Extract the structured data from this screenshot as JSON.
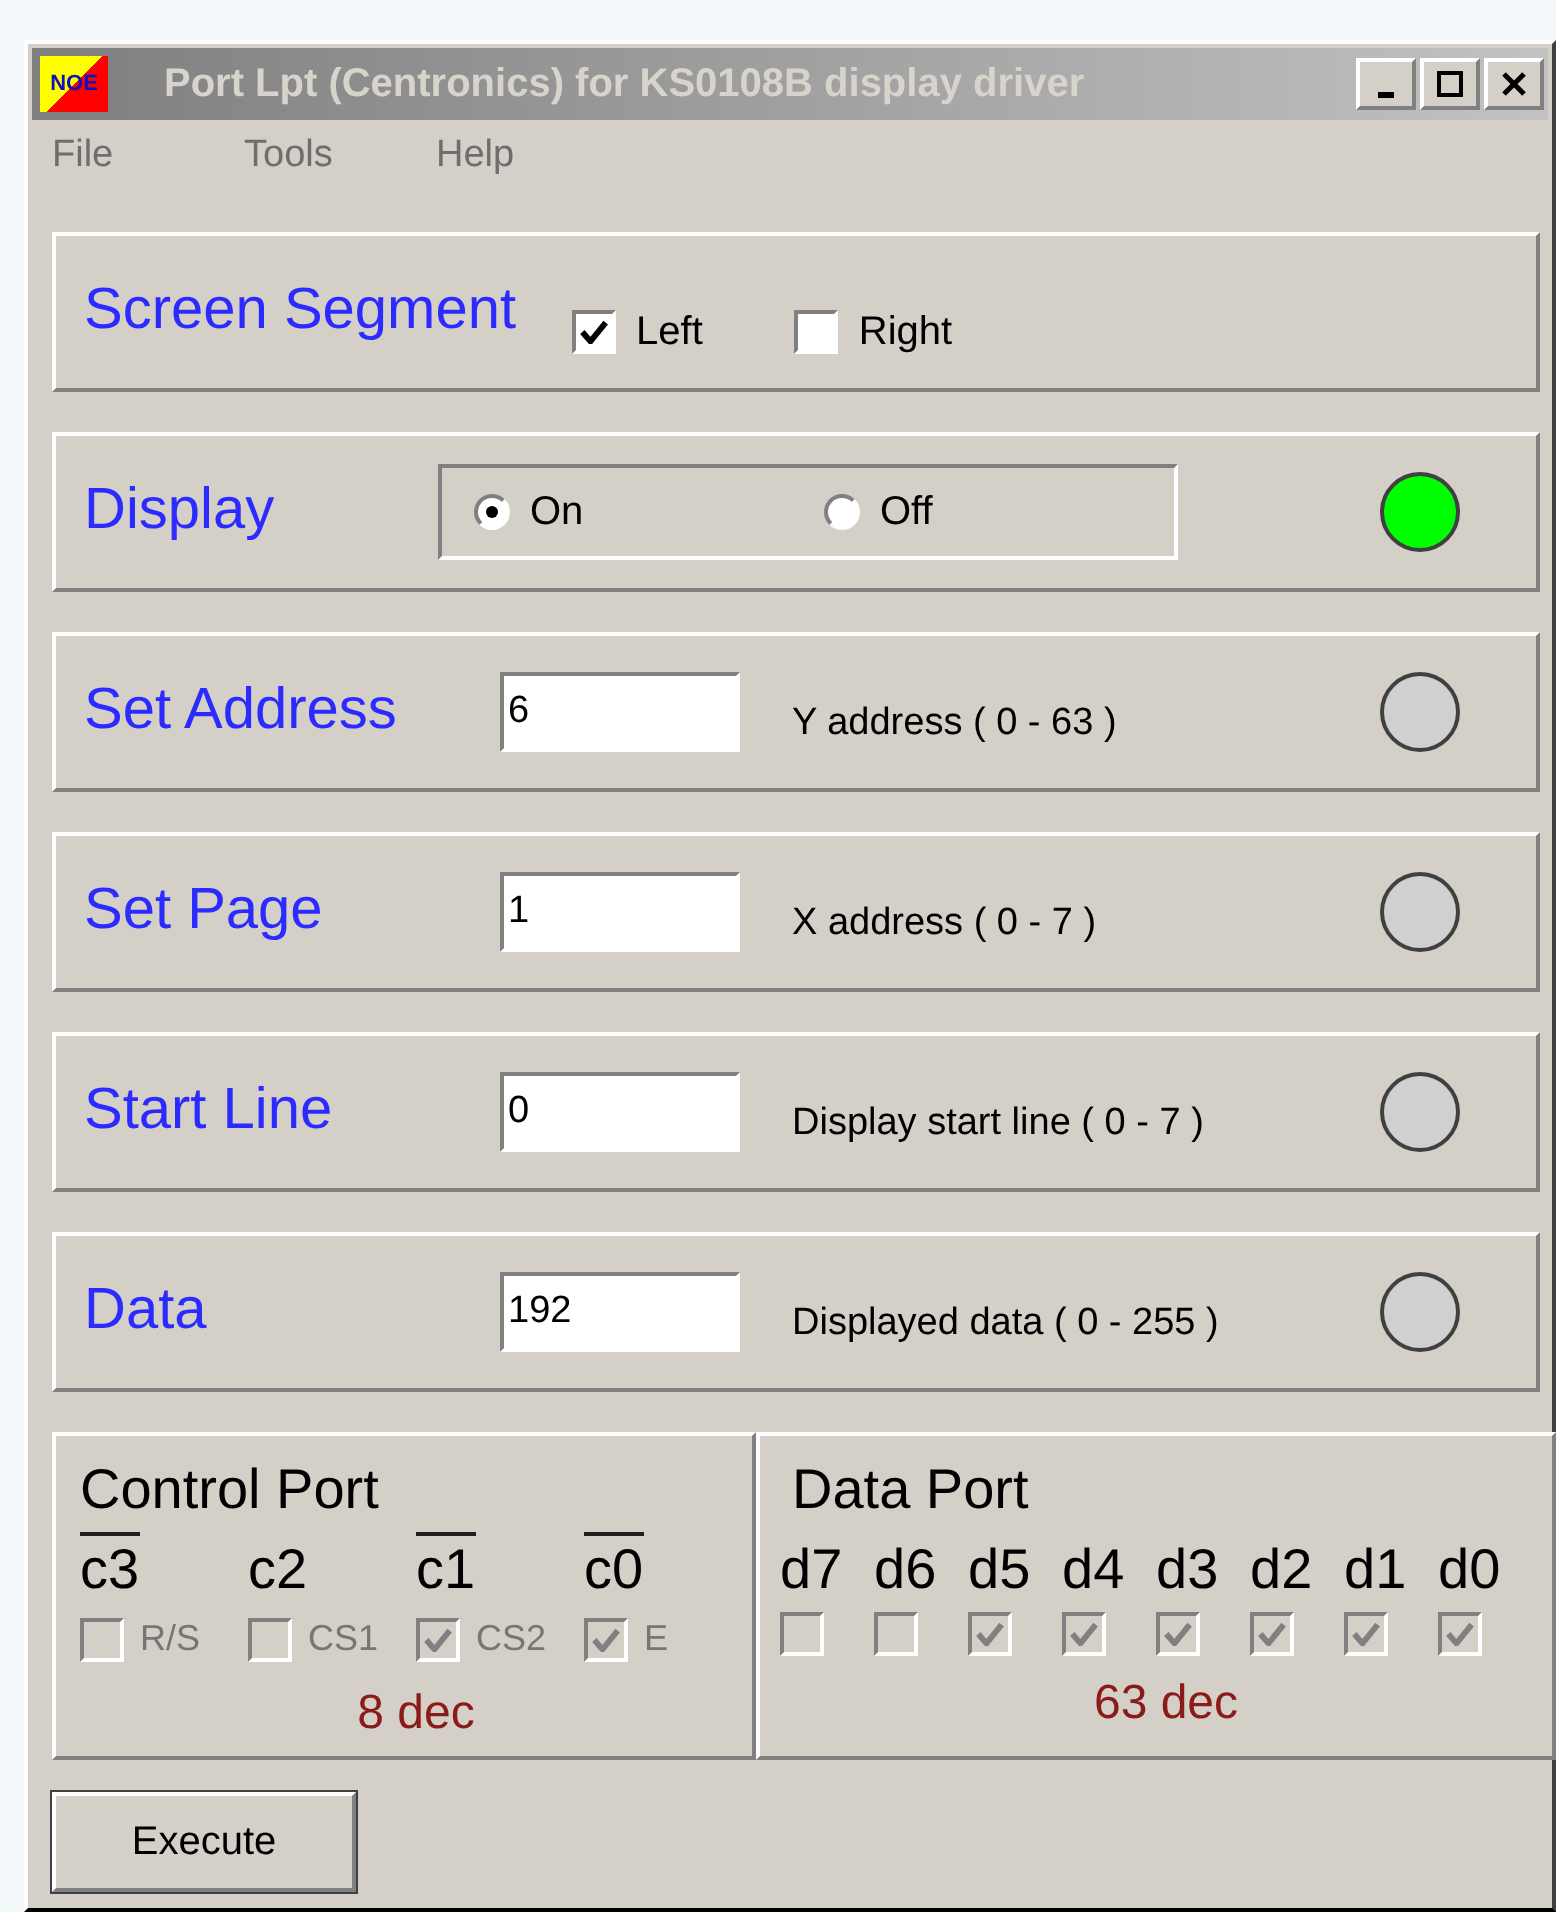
{
  "window": {
    "title": "Port Lpt (Centronics) for KS0108B display driver",
    "logo": "NOE"
  },
  "menu": [
    {
      "label": "File"
    },
    {
      "label": "Tools"
    },
    {
      "label": "Help"
    }
  ],
  "segment": {
    "label": "Screen Segment",
    "options": [
      {
        "label": "Left",
        "checked": true
      },
      {
        "label": "Right",
        "checked": false
      }
    ]
  },
  "display": {
    "label": "Display",
    "radios": [
      {
        "label": "On",
        "selected": true
      },
      {
        "label": "Off",
        "selected": false
      }
    ],
    "on": true
  },
  "rows": [
    {
      "label": "Set Address",
      "value": "6",
      "hint": "Y address ( 0 - 63  )",
      "on": false
    },
    {
      "label": "Set Page",
      "value": "1",
      "hint": "X address ( 0 - 7  )",
      "on": false
    },
    {
      "label": "Start Line",
      "value": "0",
      "hint": "Display start line ( 0 - 7  )",
      "on": false
    },
    {
      "label": "Data",
      "value": "192",
      "hint": "Displayed data ( 0 - 255  )",
      "on": false
    }
  ],
  "control_port": {
    "title": "Control Port",
    "bits": [
      {
        "name": "c3",
        "inverted": true,
        "label": "R/S",
        "checked": false,
        "disabled": true
      },
      {
        "name": "c2",
        "inverted": false,
        "label": "CS1",
        "checked": false,
        "disabled": true
      },
      {
        "name": "c1",
        "inverted": true,
        "label": "CS2",
        "checked": true,
        "disabled": true
      },
      {
        "name": "c0",
        "inverted": true,
        "label": "E",
        "checked": true,
        "disabled": true
      }
    ],
    "value": "8 dec"
  },
  "data_port": {
    "title": "Data Port",
    "bits": [
      {
        "name": "d7",
        "checked": false,
        "disabled": true
      },
      {
        "name": "d6",
        "checked": false,
        "disabled": true
      },
      {
        "name": "d5",
        "checked": true,
        "disabled": true
      },
      {
        "name": "d4",
        "checked": true,
        "disabled": true
      },
      {
        "name": "d3",
        "checked": true,
        "disabled": true
      },
      {
        "name": "d2",
        "checked": true,
        "disabled": true
      },
      {
        "name": "d1",
        "checked": true,
        "disabled": true
      },
      {
        "name": "d0",
        "checked": true,
        "disabled": true
      }
    ],
    "value": "63 dec"
  },
  "button": {
    "label": "Execute"
  }
}
